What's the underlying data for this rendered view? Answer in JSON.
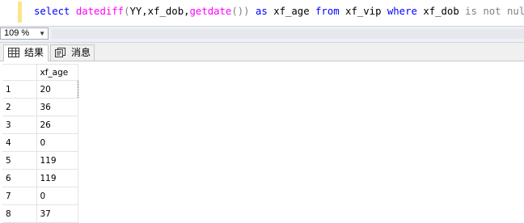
{
  "query": {
    "select": "select",
    "datediff": "datediff",
    "open_paren": "(",
    "args": "YY,xf_dob,",
    "getdate": "getdate",
    "parens_close": "())",
    "as": "as",
    "alias": "xf_age",
    "from": "from",
    "table": "xf_vip",
    "where": "where",
    "col": "xf_dob",
    "is_not_null": "is not null"
  },
  "zoom": {
    "value": "109 %"
  },
  "tabs": [
    {
      "label": "结果",
      "icon": "grid-icon",
      "active": true
    },
    {
      "label": "消息",
      "icon": "messages-icon",
      "active": false
    }
  ],
  "results": {
    "columns": [
      "xf_age"
    ],
    "rows": [
      {
        "num": "1",
        "value": "20"
      },
      {
        "num": "2",
        "value": "36"
      },
      {
        "num": "3",
        "value": "26"
      },
      {
        "num": "4",
        "value": "0"
      },
      {
        "num": "5",
        "value": "119"
      },
      {
        "num": "6",
        "value": "119"
      },
      {
        "num": "7",
        "value": "0"
      },
      {
        "num": "8",
        "value": "37"
      }
    ]
  },
  "colors": {
    "keyword": "#0000ff",
    "function": "#ff00ff",
    "operator": "#808080",
    "gutter_marker": "#fbe48a"
  }
}
